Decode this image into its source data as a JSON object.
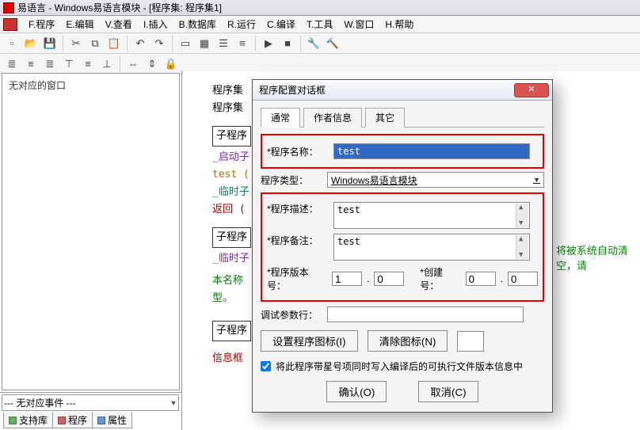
{
  "title": "易语言 - Windows易语言模块 - [程序集: 程序集1]",
  "menu": {
    "m0": "F.程序",
    "m1": "E.编辑",
    "m2": "V.查看",
    "m3": "I.插入",
    "m4": "B.数据库",
    "m5": "R.运行",
    "m6": "C.编译",
    "m7": "T.工具",
    "m8": "W.窗口",
    "m9": "H.帮助"
  },
  "left": {
    "tree_header": "无对应的窗口",
    "combo_label": "--- 无对应事件 ---",
    "tabs": {
      "t0": "支持库",
      "t1": "程序",
      "t2": "属性"
    }
  },
  "code": {
    "l0": "程序集",
    "l1": "程序集",
    "b0": "子程序",
    "l2": "_启动子",
    "l3": "test (",
    "l4": "_临时子",
    "l5": "返回 (",
    "b1": "子程序",
    "l6": "_临时子",
    "l7": "本名称",
    "l8": "型。",
    "b2": "子程序",
    "l9": "信息框"
  },
  "dialog": {
    "title": "程序配置对话框",
    "tabs": {
      "t0": "通常",
      "t1": "作者信息",
      "t2": "其它"
    },
    "labels": {
      "name": "*程序名称：",
      "type": "程序类型：",
      "desc": "*程序描述：",
      "remark": "*程序备注：",
      "ver": "*程序版本号：",
      "build": "*创建号：",
      "debug": "调试参数行："
    },
    "values": {
      "name": "test",
      "type": "Windows易语言模块",
      "desc": "test",
      "remark": "test",
      "ver_major": "1",
      "ver_minor": "0",
      "build_major": "0",
      "build_minor": "0",
      "debug": ""
    },
    "buttons": {
      "seticon": "设置程序图标(I)",
      "clricon": "清除图标(N)",
      "ok": "确认(O)",
      "cancel": "取消(C)"
    },
    "checkbox": "将此程序带星号项同时写入编译后的可执行文件版本信息中"
  },
  "hint_right": "将被系统自动清空，请"
}
